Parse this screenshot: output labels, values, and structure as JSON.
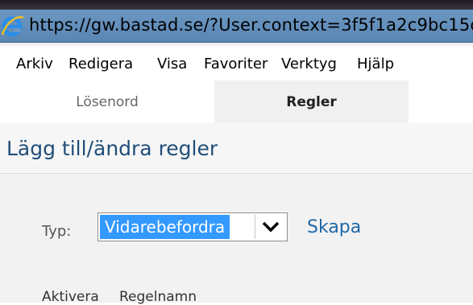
{
  "browser": {
    "url": "https://gw.bastad.se/?User.context=3f5f1a2c9bc15c"
  },
  "menu": {
    "items": [
      "Arkiv",
      "Redigera",
      "Visa",
      "Favoriter",
      "Verktyg",
      "Hjälp"
    ]
  },
  "tabs": {
    "items": [
      {
        "label": "Lösenord",
        "active": false
      },
      {
        "label": "Regler",
        "active": true
      }
    ]
  },
  "page": {
    "heading": "Lägg till/ändra regler"
  },
  "form": {
    "type_label": "Typ:",
    "type_selected": "Vidarebefordra",
    "create_link": "Skapa"
  },
  "table": {
    "columns": [
      "Aktivera",
      "Regelnamn"
    ]
  },
  "colors": {
    "selection": "#3399ff",
    "link": "#1f67a6",
    "heading": "#1f4e79"
  }
}
